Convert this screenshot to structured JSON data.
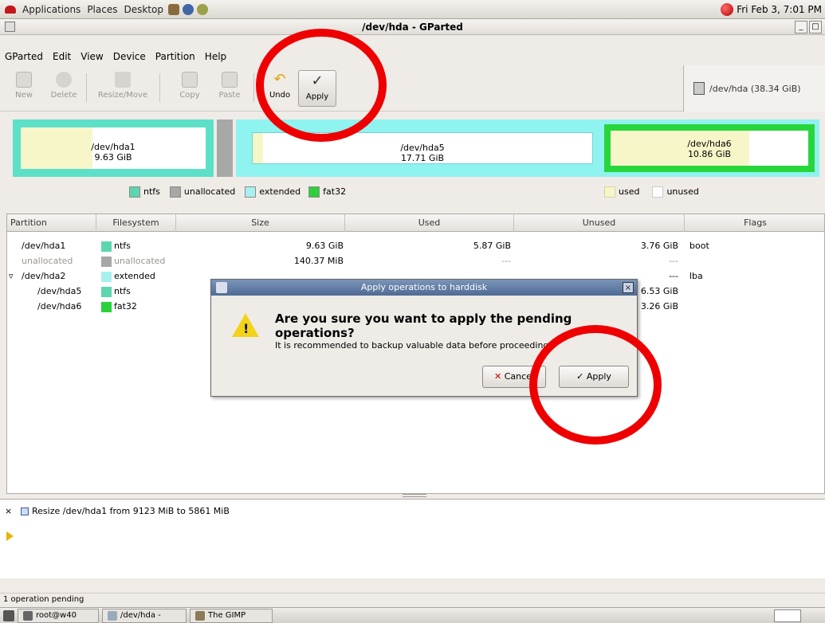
{
  "top_panel": {
    "menus": [
      "Applications",
      "Places",
      "Desktop"
    ],
    "clock": "Fri Feb 3, 7:01 PM"
  },
  "window": {
    "title": "/dev/hda - GParted"
  },
  "menubar": [
    "GParted",
    "Edit",
    "View",
    "Device",
    "Partition",
    "Help"
  ],
  "toolbar": {
    "new": "New",
    "delete": "Delete",
    "resize_move": "Resize/Move",
    "copy": "Copy",
    "paste": "Paste",
    "undo": "Undo",
    "apply": "Apply"
  },
  "device_selector": "/dev/hda (38.34 GiB)",
  "partition_map": [
    {
      "name": "/dev/hda1",
      "size": "9.63 GiB",
      "border": "#5ce1c8",
      "used_fraction": 0.39
    },
    {
      "name": "/dev/hda5",
      "size": "17.71 GiB",
      "border": "#8ff3ef",
      "used_fraction": 0.03
    },
    {
      "name": "/dev/hda6",
      "size": "10.86 GiB",
      "border": "#27d63b",
      "used_fraction": 0.7
    }
  ],
  "legend": {
    "ntfs": "ntfs",
    "unallocated": "unallocated",
    "extended": "extended",
    "fat32": "fat32",
    "used": "used",
    "unused": "unused"
  },
  "table": {
    "headers": [
      "Partition",
      "Filesystem",
      "Size",
      "Used",
      "Unused",
      "Flags"
    ],
    "rows": [
      {
        "partition": "/dev/hda1",
        "filesystem": "ntfs",
        "color": "#5cd6b0",
        "size": "9.63 GiB",
        "used": "5.87 GiB",
        "unused": "3.76 GiB",
        "flags": "boot"
      },
      {
        "partition": "unallocated",
        "filesystem": "unallocated",
        "color": "#a7a7a7",
        "size": "140.37 MiB",
        "used": "---",
        "unused": "---",
        "flags": ""
      },
      {
        "partition": "/dev/hda2",
        "filesystem": "extended",
        "color": "#a6f0f0",
        "size": "",
        "used": "",
        "unused": "---",
        "flags": "lba"
      },
      {
        "partition": "/dev/hda5",
        "filesystem": "ntfs",
        "color": "#5cd6b0",
        "size": "",
        "used": "",
        "unused": "6.53 GiB",
        "flags": ""
      },
      {
        "partition": "/dev/hda6",
        "filesystem": "fat32",
        "color": "#2bd13c",
        "size": "",
        "used": "",
        "unused": "3.26 GiB",
        "flags": ""
      }
    ]
  },
  "dialog": {
    "title": "Apply operations to harddisk",
    "heading": "Are you sure you want to apply the pending operations?",
    "text": "It is recommended to backup valuable data before proceeding.",
    "cancel": "Cancel",
    "apply": "Apply"
  },
  "operations": {
    "item": "Resize /dev/hda1 from 9123 MiB to 5861 MiB"
  },
  "status": "1 operation pending",
  "taskbar": [
    "root@w40",
    "/dev/hda -",
    "The GIMP"
  ]
}
